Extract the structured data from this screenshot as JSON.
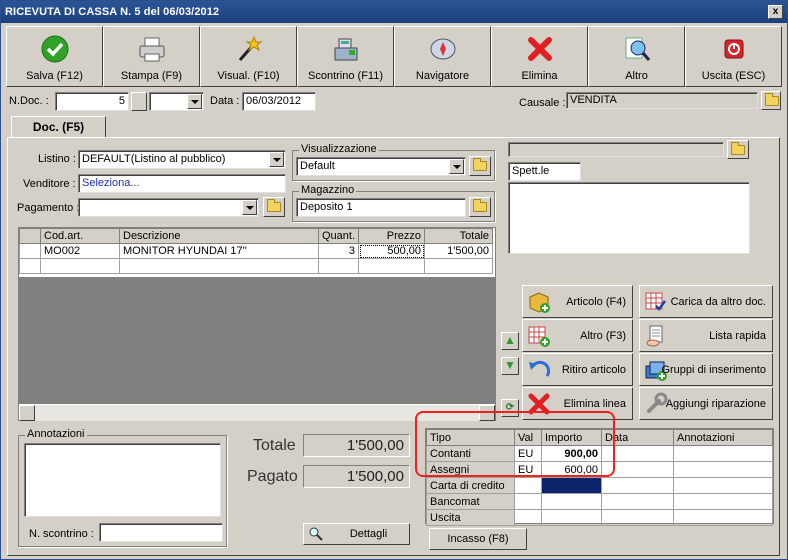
{
  "window": {
    "title": "RICEVUTA DI CASSA N. 5  del 06/03/2012",
    "close": "x"
  },
  "toolbar": [
    {
      "label": "Salva (F12)",
      "icon": "check-icon"
    },
    {
      "label": "Stampa (F9)",
      "icon": "printer-icon"
    },
    {
      "label": "Visual. (F10)",
      "icon": "magic-wand-icon"
    },
    {
      "label": "Scontrino (F11)",
      "icon": "cash-register-icon"
    },
    {
      "label": "Navigatore",
      "icon": "compass-icon"
    },
    {
      "label": "Elimina",
      "icon": "delete-icon"
    },
    {
      "label": "Altro",
      "icon": "magnifier-icon"
    },
    {
      "label": "Uscita (ESC)",
      "icon": "power-icon"
    }
  ],
  "header": {
    "ndoc_label": "N.Doc. :",
    "ndoc_value": "5",
    "data_label": "Data :",
    "data_value": "06/03/2012",
    "causale_label": "Causale :",
    "causale_value": "VENDITA"
  },
  "tab": {
    "label": "Doc. (F5)"
  },
  "form": {
    "listino_label": "Listino :",
    "listino_value": "DEFAULT(Listino al pubblico)",
    "venditore_label": "Venditore :",
    "venditore_value": "Seleziona...",
    "pagamento_label": "Pagamento :",
    "pagamento_value": "",
    "visualizzazione_title": "Visualizzazione",
    "visualizzazione_value": "Default",
    "magazzino_title": "Magazzino",
    "magazzino_value": "Deposito 1",
    "cliente_value": "",
    "spett_value": "Spett.le",
    "address_value": ""
  },
  "grid": {
    "columns": [
      "Cod.art.",
      "Descrizione",
      "Quant.",
      "Prezzo",
      "Totale"
    ],
    "rows": [
      [
        "MO002",
        "MONITOR HYUNDAI 17''",
        "3",
        "500,00",
        "1'500,00"
      ]
    ]
  },
  "actions": [
    {
      "label": "Articolo (F4)",
      "icon": "box-add-icon"
    },
    {
      "label": "Carica da altro doc.",
      "icon": "grid-check-icon"
    },
    {
      "label": "Altro (F3)",
      "icon": "grid-add-icon"
    },
    {
      "label": "Lista rapida",
      "icon": "list-hand-icon"
    },
    {
      "label": "Ritiro articolo",
      "icon": "undo-arrow-icon"
    },
    {
      "label": "Gruppi di inserimento",
      "icon": "group-add-icon"
    },
    {
      "label": "Elimina linea",
      "icon": "delete-line-icon"
    },
    {
      "label": "Aggiungi riparazione",
      "icon": "wrench-icon"
    }
  ],
  "annotazioni": {
    "title": "Annotazioni",
    "value": "",
    "scontrino_label": "N. scontrino :",
    "scontrino_value": ""
  },
  "totals": {
    "totale_label": "Totale",
    "totale_value": "1'500,00",
    "pagato_label": "Pagato",
    "pagato_value": "1'500,00",
    "dettagli_label": "Dettagli"
  },
  "payments": {
    "columns": [
      "Tipo",
      "Val",
      "Importo",
      "Data",
      "Annotazioni"
    ],
    "rows": [
      [
        "Contanti",
        "EU",
        "900,00",
        "",
        ""
      ],
      [
        "Assegni",
        "EU",
        "600,00",
        "",
        ""
      ],
      [
        "Carta di credito",
        "",
        "",
        "",
        ""
      ],
      [
        "Bancomat",
        "",
        "",
        "",
        ""
      ],
      [
        "Uscita",
        "",
        "",
        "",
        ""
      ]
    ]
  },
  "incasso_label": "Incasso (F8)"
}
